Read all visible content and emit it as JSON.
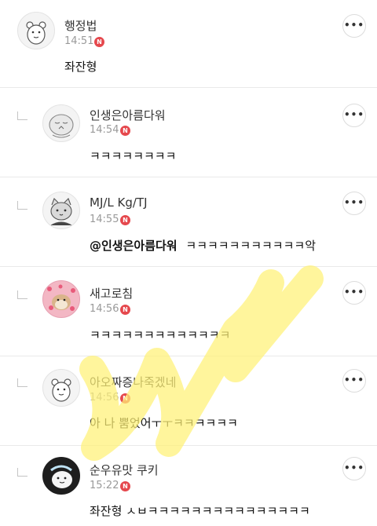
{
  "comments": [
    {
      "nickname": "행정법",
      "time": "14:51",
      "badge": "N",
      "text": "좌잔형",
      "mention": "",
      "more": "•••",
      "avatar": "bear-face-avatar"
    },
    {
      "nickname": "인생은아름다워",
      "time": "14:54",
      "badge": "N",
      "text": "ㅋㅋㅋㅋㅋㅋㅋㅋ",
      "mention": "",
      "more": "•••",
      "avatar": "sleeping-character-avatar"
    },
    {
      "nickname": "MJ/L Kg/TJ",
      "time": "14:55",
      "badge": "N",
      "text": "ㅋㅋㅋㅋㅋㅋㅋㅋㅋㅋㅋ악",
      "mention": "@인생은아름다워",
      "more": "•••",
      "avatar": "cat-character-avatar"
    },
    {
      "nickname": "새고로침",
      "time": "14:56",
      "badge": "N",
      "text": "ㅋㅋㅋㅋㅋㅋㅋㅋㅋㅋㅋㅋㅋ",
      "mention": "",
      "more": "•••",
      "avatar": "hamster-photo-avatar"
    },
    {
      "nickname": "아오짜증나죽겠네",
      "time": "14:56",
      "badge": "N",
      "text": "아 나 뿜었어ㅜㅜㅋㅋㅋㅋㅋㅋ",
      "mention": "",
      "more": "•••",
      "avatar": "bear-face-avatar"
    },
    {
      "nickname": "순우유맛 쿠키",
      "time": "15:22",
      "badge": "N",
      "text": "좌잔형 ㅅㅂㅋㅋㅋㅋㅋㅋㅋㅋㅋㅋㅋㅋㅋㅋㅋ",
      "mention": "",
      "more": "•••",
      "avatar": "cookie-character-avatar"
    }
  ],
  "colors": {
    "badge": "#e5484d",
    "highlighter": "#fff176",
    "divider": "#e9e9e9"
  }
}
